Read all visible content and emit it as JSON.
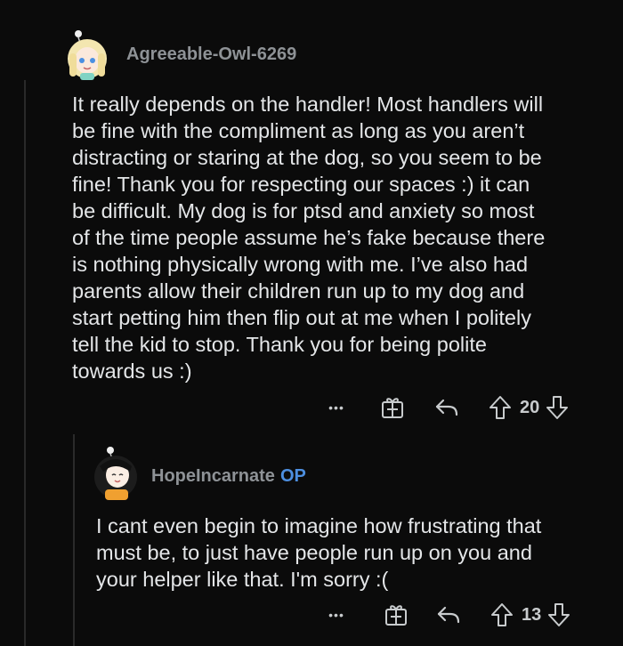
{
  "comments": [
    {
      "username": "Agreeable-Owl-6269",
      "body": "It really depends on the handler! Most handlers will\nbe fine with the compliment as long as you aren’t\ndistracting or staring at the dog, so you seem to be\nfine! Thank you for respecting our spaces :) it can\nbe difficult. My dog is for ptsd and anxiety so most\nof the time people assume he’s fake because there\nis nothing physically wrong with me. I’ve also had\nparents allow their children run up to my dog and\nstart petting him then flip out at me when I politely\ntell the kid to stop. Thank you for being polite\ntowards us :)",
      "votes": "20",
      "more_label": "•••"
    },
    {
      "username": "HopeIncarnate",
      "op_badge": "OP",
      "body": "I cant even begin to imagine how frustrating that\nmust be, to just have people run up on you and\nyour helper like that. I'm sorry :(",
      "votes": "13",
      "more_label": "•••"
    }
  ],
  "colors": {
    "background": "#0b0b0b",
    "username": "#8e9296",
    "op_badge": "#4d8fe0",
    "body_text": "#e4e6e8",
    "icon": "#c8cbcd"
  },
  "icons": [
    "more-icon",
    "award-icon",
    "reply-icon",
    "upvote-icon",
    "downvote-icon"
  ]
}
